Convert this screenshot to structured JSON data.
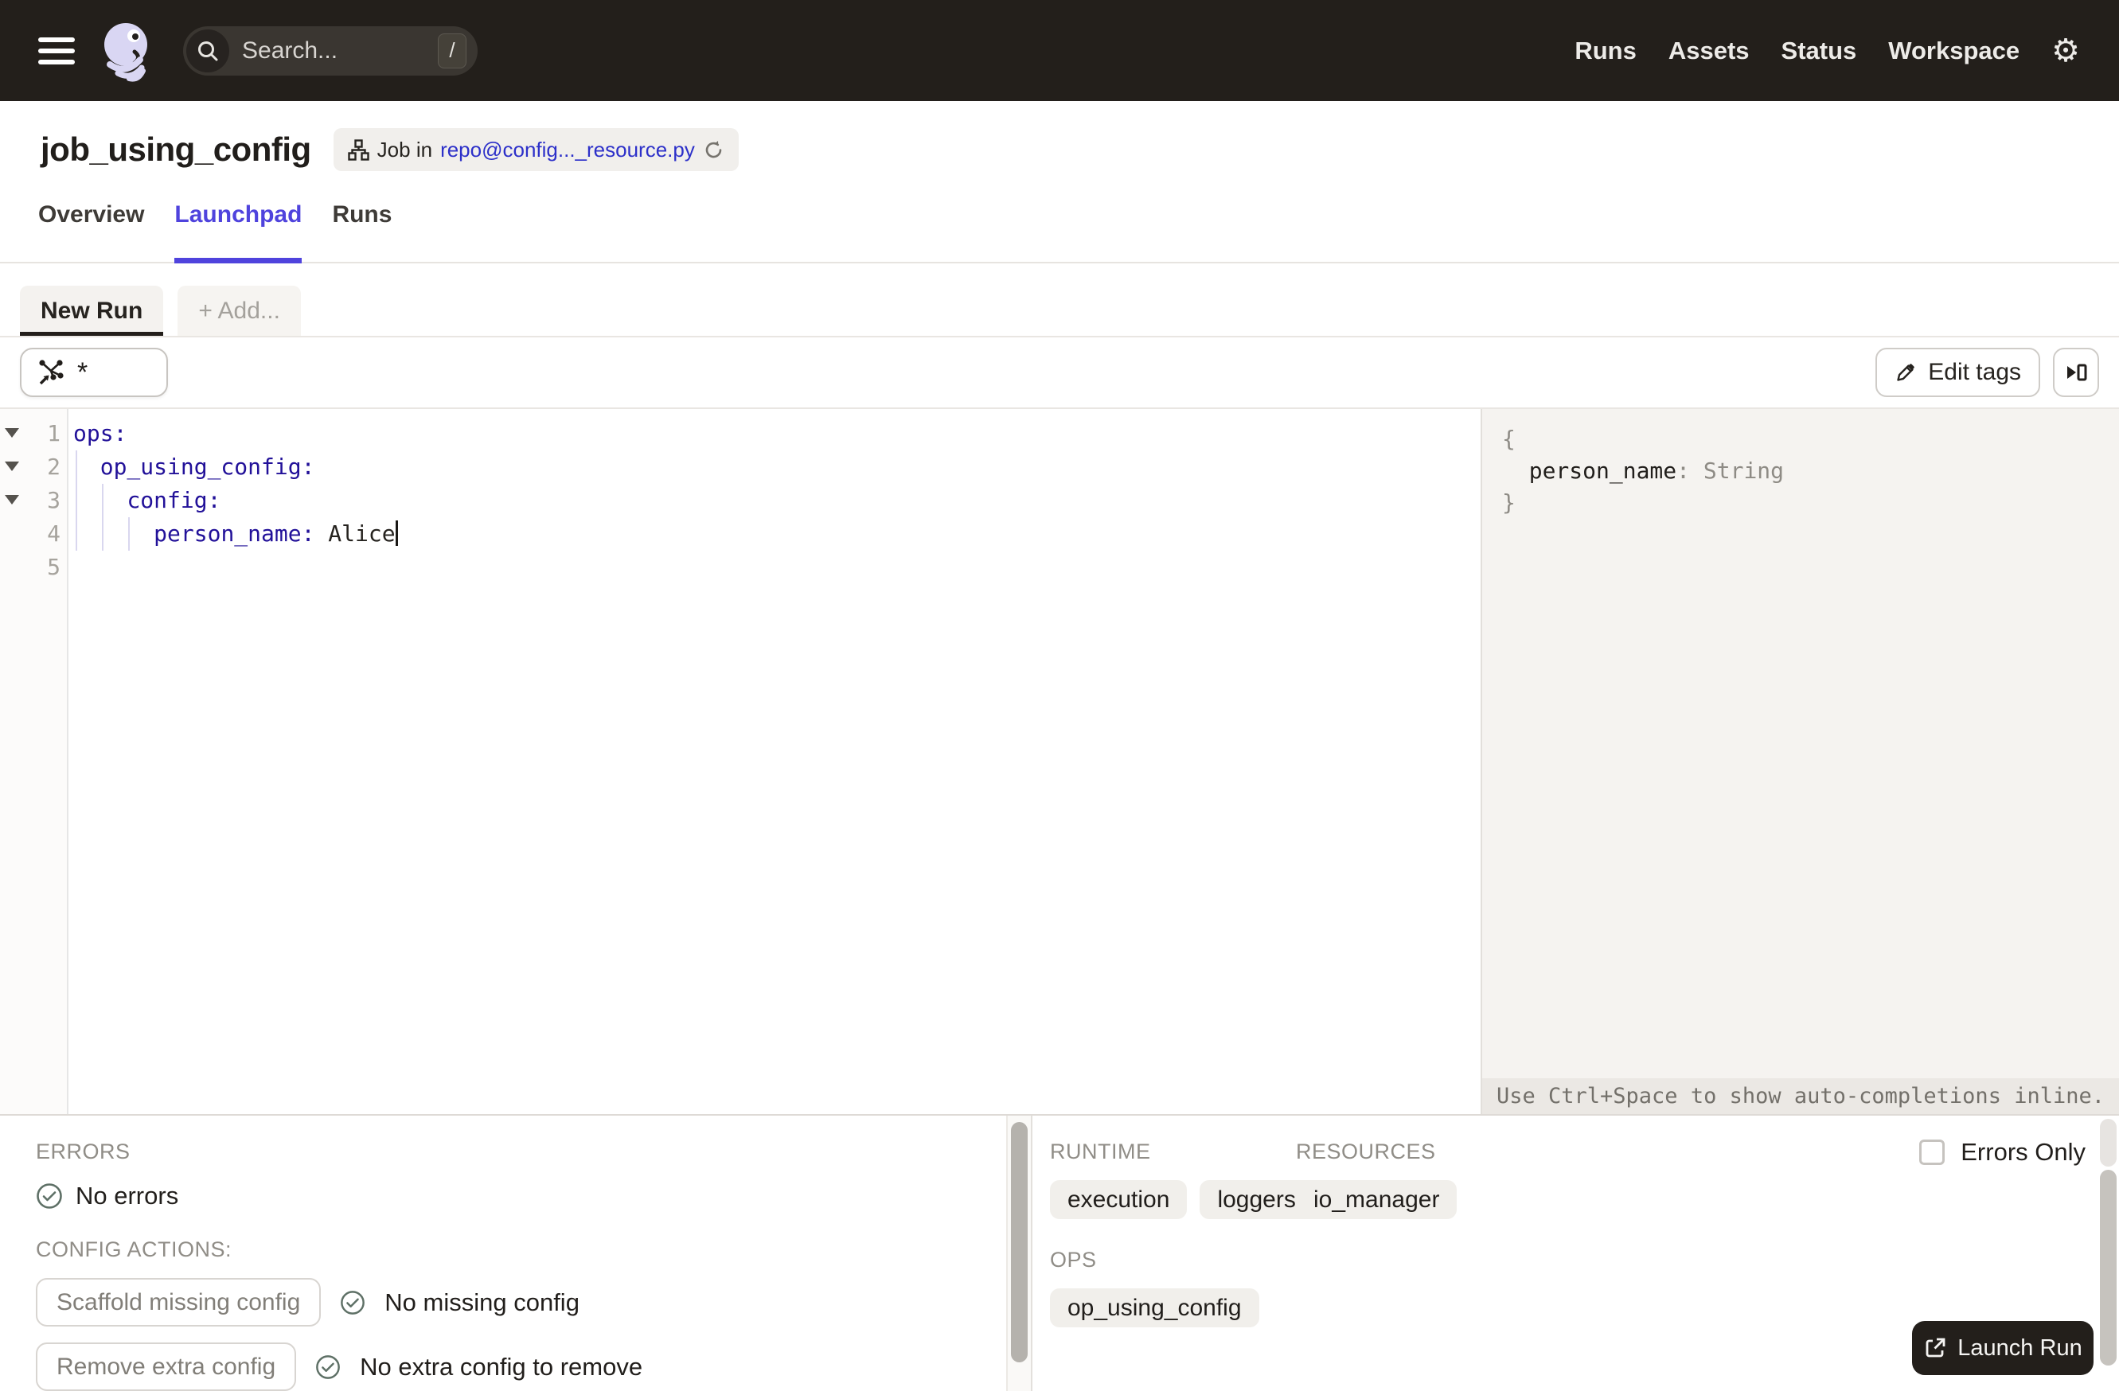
{
  "nav": {
    "search_placeholder": "Search...",
    "search_shortcut": "/",
    "links": [
      "Runs",
      "Assets",
      "Status",
      "Workspace"
    ]
  },
  "header": {
    "title": "job_using_config",
    "badge_prefix": "Job in",
    "badge_link": "repo@config..._resource.py"
  },
  "tabs": [
    {
      "label": "Overview"
    },
    {
      "label": "Launchpad"
    },
    {
      "label": "Runs"
    }
  ],
  "launchpad": {
    "run_tabs": {
      "new_run": "New Run",
      "add": "+ Add..."
    },
    "op_selector_value": "*",
    "edit_tags_label": "Edit tags",
    "editor": {
      "line_numbers": [
        "1",
        "2",
        "3",
        "4",
        "5"
      ],
      "lines": [
        {
          "indent": "",
          "key": "ops:",
          "value": ""
        },
        {
          "indent": "  ",
          "key": "op_using_config:",
          "value": ""
        },
        {
          "indent": "    ",
          "key": "config:",
          "value": ""
        },
        {
          "indent": "      ",
          "key": "person_name:",
          "value": " Alice"
        },
        {
          "indent": "",
          "key": "",
          "value": ""
        }
      ]
    },
    "schema": {
      "brace_open": "{",
      "entry_indent": "  ",
      "entry_key": "person_name",
      "entry_sep": ": ",
      "entry_type": "String",
      "brace_close": "}"
    },
    "hint": "Use Ctrl+Space to show auto-completions inline."
  },
  "bottom": {
    "errors_label": "ERRORS",
    "errors_status": "No errors",
    "config_actions_label": "CONFIG ACTIONS:",
    "actions": [
      {
        "button": "Scaffold missing config",
        "status": "No missing config"
      },
      {
        "button": "Remove extra config",
        "status": "No extra config to remove"
      }
    ],
    "runtime_label": "RUNTIME",
    "runtime_tags": [
      "execution",
      "loggers"
    ],
    "resources_label": "RESOURCES",
    "resources_tags": [
      "io_manager"
    ],
    "ops_label": "OPS",
    "ops_tags": [
      "op_using_config"
    ],
    "errors_only_label": "Errors Only",
    "launch_label": "Launch Run"
  },
  "colors": {
    "accent": "#4F43DD",
    "link": "#2D30C9",
    "yaml_key": "#221199",
    "nav_bg": "#231F1B",
    "logo_lavender": "#D9D6F3"
  }
}
